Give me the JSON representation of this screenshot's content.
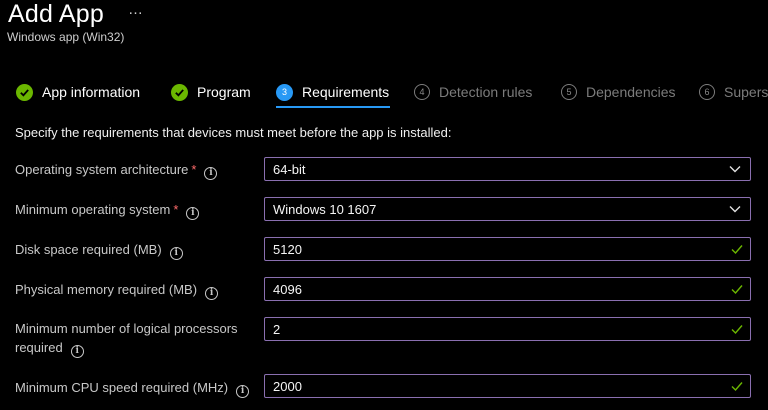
{
  "header": {
    "title": "Add App",
    "more": "…",
    "subtitle": "Windows app (Win32)"
  },
  "tabs": [
    {
      "label": "App information",
      "state": "done",
      "number": ""
    },
    {
      "label": "Program",
      "state": "done",
      "number": ""
    },
    {
      "label": "Requirements",
      "state": "active",
      "number": "3"
    },
    {
      "label": "Detection rules",
      "state": "pending",
      "number": "4"
    },
    {
      "label": "Dependencies",
      "state": "pending",
      "number": "5"
    },
    {
      "label": "Supers",
      "state": "pending",
      "number": "6"
    }
  ],
  "intro": "Specify the requirements that devices must meet before the app is installed:",
  "fields": {
    "os_arch": {
      "label": "Operating system architecture",
      "required": "*",
      "value": "64-bit",
      "type": "dropdown"
    },
    "min_os": {
      "label": "Minimum operating system",
      "required": "*",
      "value": "Windows 10 1607",
      "type": "dropdown"
    },
    "disk": {
      "label": "Disk space required (MB)",
      "value": "5120",
      "type": "text"
    },
    "memory": {
      "label": "Physical memory required (MB)",
      "value": "4096",
      "type": "text"
    },
    "processors": {
      "label_line1": "Minimum number of logical processors",
      "label_line2": "required",
      "value": "2",
      "type": "text"
    },
    "cpu_speed": {
      "label": "Minimum CPU speed required (MHz)",
      "value": "2000",
      "type": "text"
    }
  },
  "colors": {
    "accent": "#2899f5",
    "check": "#6bb700",
    "field_border": "#8a6fb0",
    "required": "#ff6b6b"
  }
}
